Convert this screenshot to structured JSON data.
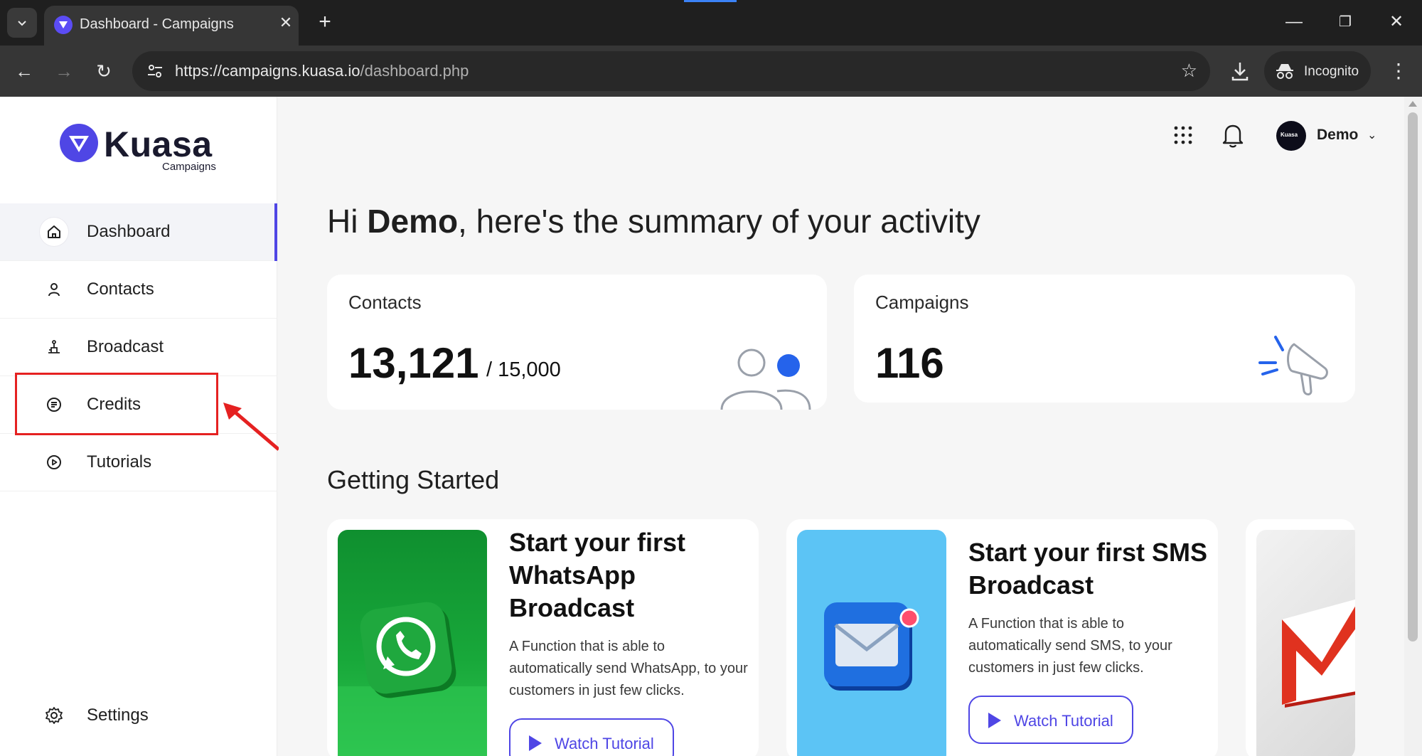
{
  "browser": {
    "tab_title": "Dashboard - Campaigns",
    "tab_close": "✕",
    "new_tab": "+",
    "url_host": "https://campaigns.kuasa.io",
    "url_path": "/dashboard.php",
    "incognito_label": "Incognito",
    "window_controls": {
      "minimize": "—",
      "restore": "❐",
      "close": "✕"
    },
    "nav": {
      "back": "←",
      "forward": "→",
      "reload": "↻",
      "star": "☆",
      "menu": "⋮"
    }
  },
  "app": {
    "logo_name": "Kuasa",
    "logo_sub": "Campaigns",
    "accent_color": "#4f46e5"
  },
  "sidebar": {
    "items": [
      {
        "label": "Dashboard",
        "icon": "home-icon",
        "active": true
      },
      {
        "label": "Contacts",
        "icon": "user-icon"
      },
      {
        "label": "Broadcast",
        "icon": "broadcast-icon"
      },
      {
        "label": "Credits",
        "icon": "credits-icon"
      },
      {
        "label": "Tutorials",
        "icon": "play-circle-icon"
      }
    ],
    "settings_label": "Settings"
  },
  "header": {
    "user_name": "Demo",
    "avatar_text": "Kuasa"
  },
  "main": {
    "greeting_prefix": "Hi ",
    "greeting_name": "Demo",
    "greeting_suffix": ", here's the summary of your activity",
    "stats": {
      "contacts_title": "Contacts",
      "contacts_value": "13,121",
      "contacts_total": "/ 15,000",
      "campaigns_title": "Campaigns",
      "campaigns_value": "116"
    },
    "getting_started_title": "Getting Started",
    "cards": {
      "whatsapp_heading": "Start your first WhatsApp Broadcast",
      "whatsapp_desc": "A Function that is able to automatically send WhatsApp, to your customers in just few clicks.",
      "sms_heading": "Start your first SMS Broadcast",
      "sms_desc": "A Function that is able to automatically send SMS, to your customers in just few clicks.",
      "button_label": "Watch Tutorial"
    }
  }
}
